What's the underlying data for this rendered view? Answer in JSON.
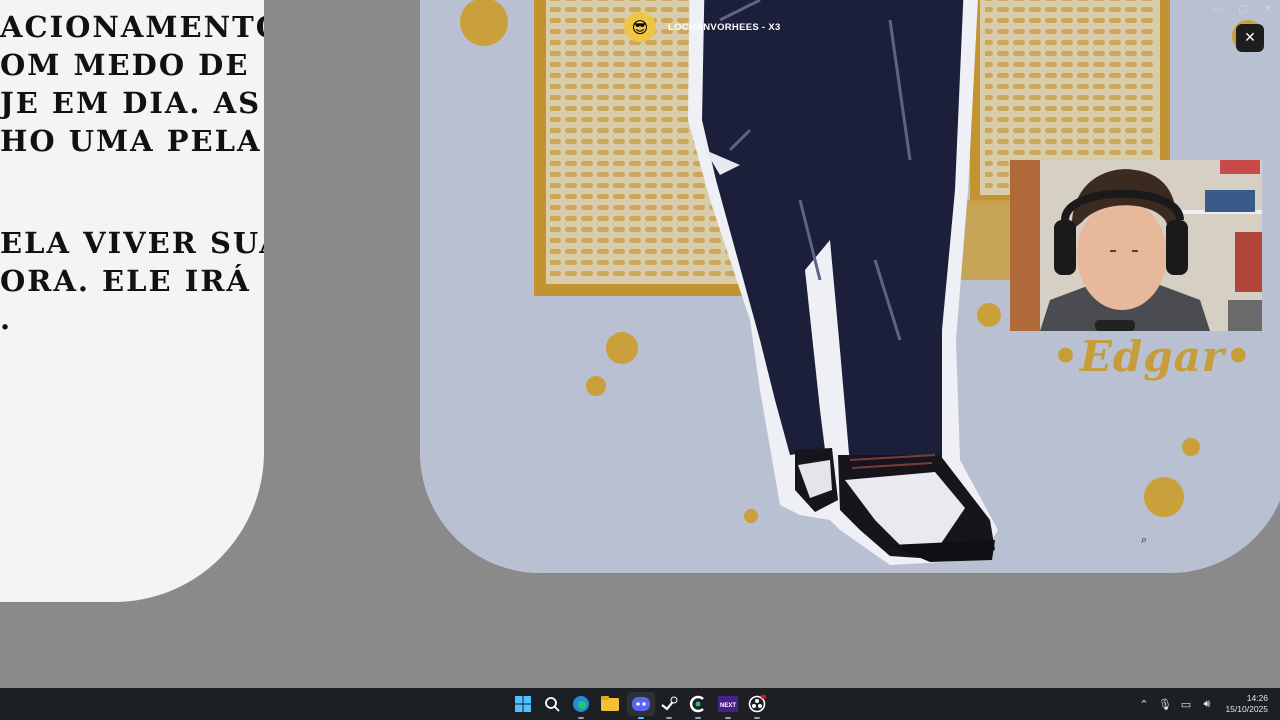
{
  "text_card": {
    "lines": [
      "ACIONAMENTO.",
      "OM MEDO DE",
      "JE EM DIA. AS",
      "HO UMA PELA",
      "ELA VIVER SUA",
      "ORA. ELE IRÁ",
      "."
    ]
  },
  "stream": {
    "streamer_name": "LOCHANVORHEES - X3",
    "close_label": "✕"
  },
  "drawing": {
    "signature": "•Edgar•"
  },
  "taskbar": {
    "icons": [
      "windows-start-icon",
      "search-icon",
      "edge-icon",
      "file-explorer-icon",
      "discord-icon",
      "steam-icon",
      "ccleaner-icon",
      "next-app-icon",
      "obs-icon"
    ],
    "time": "14:26",
    "date": "15/10/2025"
  },
  "colors": {
    "background": "#8a8a8a",
    "card": "#f4f4f4",
    "paper": "#b8c0d2",
    "gold": "#c79d3a",
    "jeans": "#1b1f3a",
    "taskbar": "#1c1f24"
  }
}
